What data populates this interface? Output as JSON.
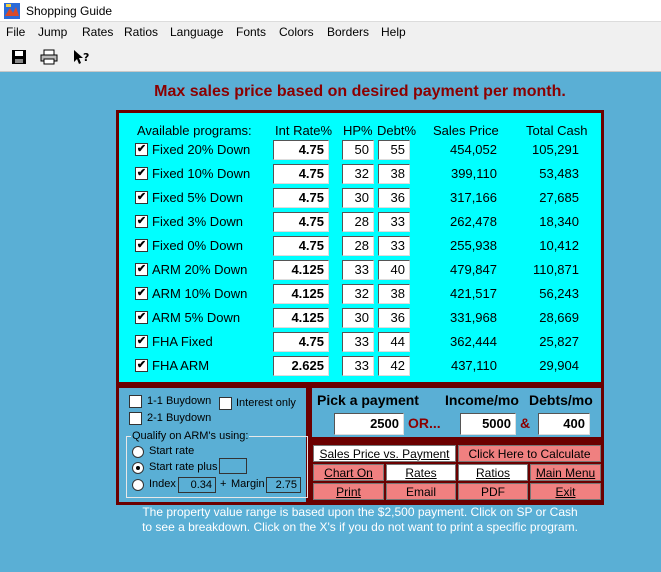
{
  "window": {
    "title": "Shopping Guide"
  },
  "menu": [
    "File",
    "Jump",
    "Rates",
    "Ratios",
    "Language",
    "Fonts",
    "Colors",
    "Borders",
    "Help"
  ],
  "heading": "Max sales price based on desired payment per month.",
  "columns": {
    "programs": "Available programs:",
    "int_rate": "Int Rate%",
    "hp": "HP%",
    "debt": "Debt%",
    "sales_price": "Sales Price",
    "total_cash": "Total Cash"
  },
  "programs": [
    {
      "checked": true,
      "name": "Fixed 20% Down",
      "rate": "4.75",
      "hp": "50",
      "debt": "55",
      "sales_price": "454,052",
      "total_cash": "105,291"
    },
    {
      "checked": true,
      "name": "Fixed 10% Down",
      "rate": "4.75",
      "hp": "32",
      "debt": "38",
      "sales_price": "399,110",
      "total_cash": "53,483"
    },
    {
      "checked": true,
      "name": "Fixed 5% Down",
      "rate": "4.75",
      "hp": "30",
      "debt": "36",
      "sales_price": "317,166",
      "total_cash": "27,685"
    },
    {
      "checked": true,
      "name": "Fixed 3% Down",
      "rate": "4.75",
      "hp": "28",
      "debt": "33",
      "sales_price": "262,478",
      "total_cash": "18,340"
    },
    {
      "checked": true,
      "name": "Fixed 0% Down",
      "rate": "4.75",
      "hp": "28",
      "debt": "33",
      "sales_price": "255,938",
      "total_cash": "10,412"
    },
    {
      "checked": true,
      "name": "ARM 20% Down",
      "rate": "4.125",
      "hp": "33",
      "debt": "40",
      "sales_price": "479,847",
      "total_cash": "110,871"
    },
    {
      "checked": true,
      "name": "ARM 10% Down",
      "rate": "4.125",
      "hp": "32",
      "debt": "38",
      "sales_price": "421,517",
      "total_cash": "56,243"
    },
    {
      "checked": true,
      "name": "ARM 5% Down",
      "rate": "4.125",
      "hp": "30",
      "debt": "36",
      "sales_price": "331,968",
      "total_cash": "28,669"
    },
    {
      "checked": true,
      "name": "FHA Fixed",
      "rate": "4.75",
      "hp": "33",
      "debt": "44",
      "sales_price": "362,444",
      "total_cash": "25,827"
    },
    {
      "checked": true,
      "name": "FHA ARM",
      "rate": "2.625",
      "hp": "33",
      "debt": "42",
      "sales_price": "437,110",
      "total_cash": "29,904"
    }
  ],
  "options": {
    "buydown_1_1": "1-1 Buydown",
    "buydown_2_1": "2-1 Buydown",
    "interest_only": "Interest only",
    "qualify_label": "Qualify on ARM's using:",
    "start_rate": "Start rate",
    "start_rate_plus": "Start rate plus",
    "start_rate_plus_value": "",
    "index_label": "Index",
    "index_value": "0.34",
    "plus": "+",
    "margin_label": "Margin",
    "margin_value": "2.75"
  },
  "payment": {
    "pick_label": "Pick a payment",
    "income_label": "Income/mo",
    "debts_label": "Debts/mo",
    "payment_value": "2500",
    "or_text": "OR...",
    "income_value": "5000",
    "amp": "&",
    "debts_value": "400"
  },
  "buttons": {
    "sales_vs_payment": "Sales Price vs. Payment",
    "calculate": "Click Here to Calculate",
    "chart_on": "Chart On",
    "rates": "Rates",
    "ratios": "Ratios",
    "main_menu": "Main Menu",
    "print": "Print",
    "email": "Email",
    "pdf": "PDF",
    "exit": "Exit"
  },
  "footer": {
    "line1": "The property value range is based upon the $2,500 payment.  Click on SP or Cash",
    "line2": "to see a breakdown.  Click on the X's if you do not want to print a specific program."
  }
}
